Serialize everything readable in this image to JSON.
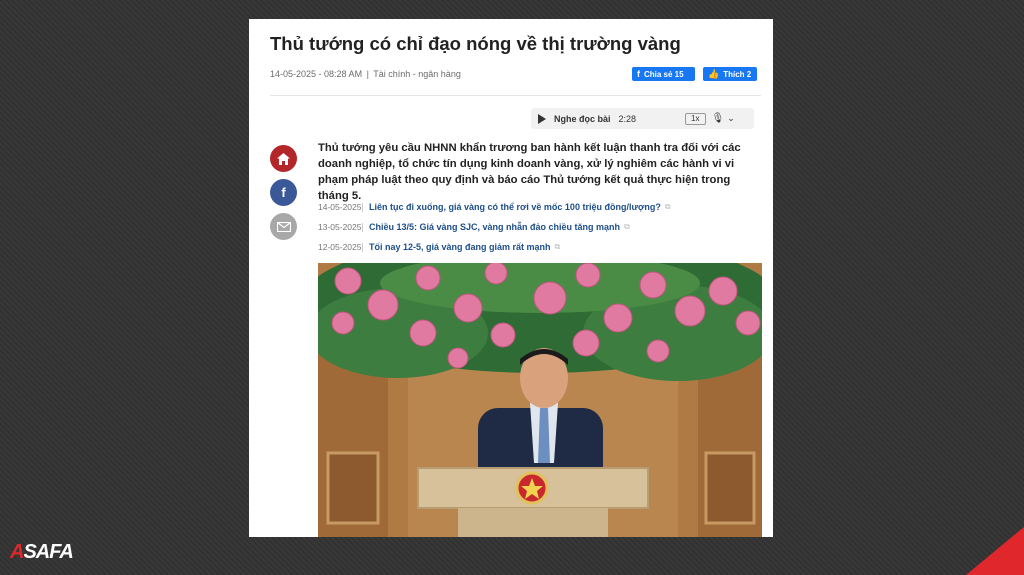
{
  "article": {
    "title": "Thủ tướng có chỉ đạo nóng về thị trường vàng",
    "datetime": "14-05-2025 - 08:28 AM",
    "separator": "|",
    "category": "Tài chính - ngân hàng",
    "share_label": "Chia sẻ 15",
    "like_label": "Thích 2",
    "sapo": "Thủ tướng yêu cầu NHNN khẩn trương ban hành kết luận thanh tra đối với các doanh nghiệp, tổ chức tín dụng kinh doanh vàng, xử lý nghiêm các hành vi vi phạm pháp luật theo quy định và báo cáo Thủ tướng kết quả thực hiện trong tháng 5."
  },
  "audio": {
    "label": "Nghe đọc bài",
    "duration": "2:28",
    "speed": "1x"
  },
  "related": [
    {
      "date": "14-05-2025",
      "title": "Liên tục đi xuống, giá vàng có thể rơi về mốc 100 triệu đồng/lượng?"
    },
    {
      "date": "13-05-2025",
      "title": "Chiều 13/5: Giá vàng SJC, vàng nhẫn đảo chiều tăng mạnh"
    },
    {
      "date": "12-05-2025",
      "title": "Tối nay 12-5, giá vàng đang giảm rất mạnh"
    }
  ],
  "icons": {
    "home": "home-icon",
    "facebook": "facebook-icon",
    "mail": "mail-icon",
    "play": "play-icon",
    "mic": "microphone-icon",
    "chevron": "chevron-down-icon"
  },
  "logo": {
    "first": "A",
    "rest": "SAFA"
  },
  "colors": {
    "background": "#333333",
    "facebook": "#1877f2",
    "home": "#b3262a",
    "brand_red": "#e0272c",
    "link": "#1d4e89"
  }
}
